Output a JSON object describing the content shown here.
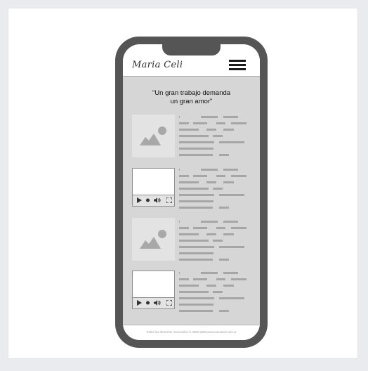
{
  "brand": {
    "logo_text": "Maria Celi"
  },
  "header": {
    "menu_icon": "hamburger-menu-icon"
  },
  "tagline": {
    "line1": "\"Un gran trabajo demanda",
    "line2": "un gran amor\""
  },
  "content": {
    "items": [
      {
        "kind": "image",
        "icon": "image-placeholder-icon"
      },
      {
        "kind": "video",
        "controls": [
          "play-icon",
          "progress-dot-icon",
          "volume-icon",
          "fullscreen-icon"
        ]
      },
      {
        "kind": "image",
        "icon": "image-placeholder-icon"
      },
      {
        "kind": "video",
        "controls": [
          "play-icon",
          "progress-dot-icon",
          "volume-icon",
          "fullscreen-icon"
        ]
      }
    ]
  },
  "footer": {
    "text": "Todos los derechos reservados © 2000-2000 www.mariaceli.com.ar"
  },
  "colors": {
    "phone_frame": "#555555",
    "screen_bg": "#d6d6d6",
    "placeholder_bar": "#a6a6a6"
  }
}
